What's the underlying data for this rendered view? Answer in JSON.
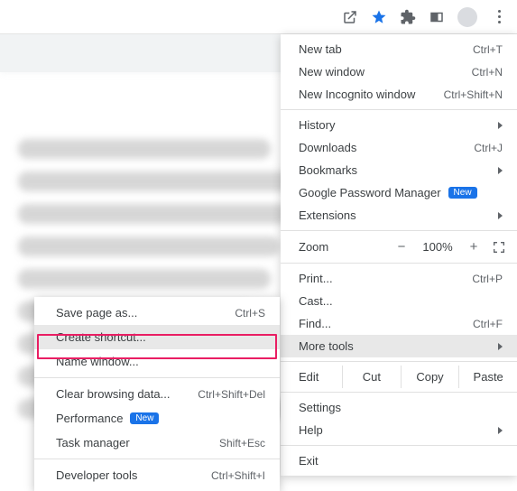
{
  "topbar": {
    "icons": [
      "share-icon",
      "star-icon",
      "puzzle-icon",
      "panel-icon",
      "avatar",
      "more-icon"
    ]
  },
  "main": {
    "newtab": {
      "label": "New tab",
      "shortcut": "Ctrl+T"
    },
    "newwin": {
      "label": "New window",
      "shortcut": "Ctrl+N"
    },
    "incog": {
      "label": "New Incognito window",
      "shortcut": "Ctrl+Shift+N"
    },
    "history": {
      "label": "History"
    },
    "downloads": {
      "label": "Downloads",
      "shortcut": "Ctrl+J"
    },
    "bookmarks": {
      "label": "Bookmarks"
    },
    "gpm": {
      "label": "Google Password Manager",
      "badge": "New"
    },
    "ext": {
      "label": "Extensions"
    },
    "zoom": {
      "label": "Zoom",
      "minus": "−",
      "value": "100%",
      "plus": "+"
    },
    "print": {
      "label": "Print...",
      "shortcut": "Ctrl+P"
    },
    "cast": {
      "label": "Cast..."
    },
    "find": {
      "label": "Find...",
      "shortcut": "Ctrl+F"
    },
    "more": {
      "label": "More tools"
    },
    "edit": {
      "label": "Edit",
      "cut": "Cut",
      "copy": "Copy",
      "paste": "Paste"
    },
    "settings": {
      "label": "Settings"
    },
    "help": {
      "label": "Help"
    },
    "exit": {
      "label": "Exit"
    }
  },
  "sub": {
    "save": {
      "label": "Save page as...",
      "shortcut": "Ctrl+S"
    },
    "shortcut": {
      "label": "Create shortcut..."
    },
    "namewin": {
      "label": "Name window..."
    },
    "clear": {
      "label": "Clear browsing data...",
      "shortcut": "Ctrl+Shift+Del"
    },
    "perf": {
      "label": "Performance",
      "badge": "New"
    },
    "task": {
      "label": "Task manager",
      "shortcut": "Shift+Esc"
    },
    "dev": {
      "label": "Developer tools",
      "shortcut": "Ctrl+Shift+I"
    }
  }
}
